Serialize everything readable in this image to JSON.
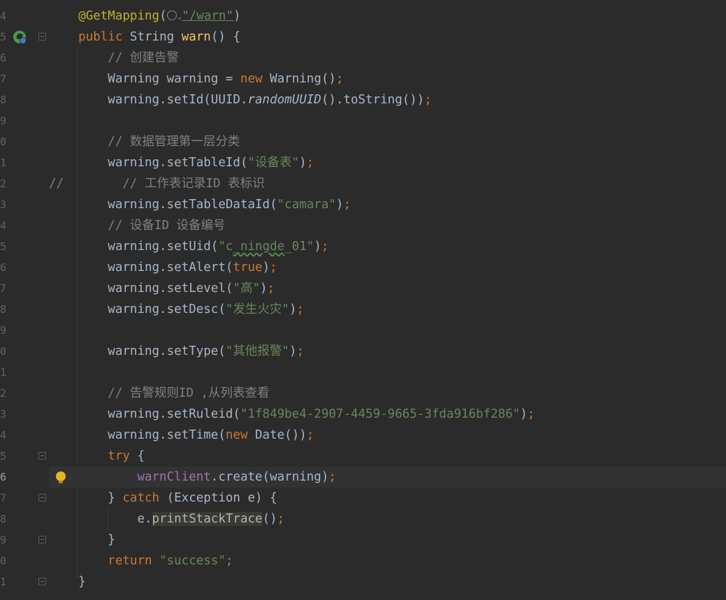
{
  "gutter": {
    "line_numbers": [
      "4",
      "5",
      "6",
      "7",
      "8",
      "9",
      "0",
      "1",
      "2",
      "3",
      "4",
      "5",
      "6",
      "7",
      "8",
      "9",
      "0",
      "1",
      "2",
      "3",
      "4",
      "5",
      "6",
      "7",
      "8",
      "9",
      "0",
      "1"
    ]
  },
  "code": {
    "l24_annotation": "@GetMapping",
    "l24_paren_open": "(",
    "l24_url": "\"/warn\"",
    "l24_paren_close": ")",
    "l25_public": "public",
    "l25_type": "String",
    "l25_method": "warn",
    "l25_rest": "() {",
    "l26_comment": "// 创建告警",
    "l27_type": "Warning warning = ",
    "l27_new": "new",
    "l27_call": " Warning()",
    "l27_semi": ";",
    "l28_a": "warning.setId(UUID.",
    "l28_it": "randomUUID",
    "l28_b": "().toString())",
    "l28_semi": ";",
    "l30_comment": "// 数据管理第一层分类",
    "l31_a": "warning.setTableId(",
    "l31_str": "\"设备表\"",
    "l31_b": ")",
    "l31_semi": ";",
    "l32_slashes": "//",
    "l32_comment": "// 工作表记录ID 表标识",
    "l33_a": "warning.setTableDataId(",
    "l33_str": "\"camara\"",
    "l33_b": ")",
    "l33_semi": ";",
    "l34_comment": "// 设备ID 设备编号",
    "l35_a": "warning.setUid(",
    "l35_q1": "\"c",
    "l35_typo": "_ningde",
    "l35_q2": "_01\"",
    "l35_b": ")",
    "l35_semi": ";",
    "l36_a": "warning.setAlert(",
    "l36_kw": "true",
    "l36_b": ")",
    "l36_semi": ";",
    "l37_a": "warning.setLevel(",
    "l37_str": "\"高\"",
    "l37_b": ")",
    "l37_semi": ";",
    "l38_a": "warning.setDesc(",
    "l38_str": "\"发生火灾\"",
    "l38_b": ")",
    "l38_semi": ";",
    "l40_a": "warning.setType(",
    "l40_str": "\"其他报警\"",
    "l40_b": ")",
    "l40_semi": ";",
    "l42_comment": "// 告警规则ID ,从列表查看",
    "l43_a": "warning.setRuleid(",
    "l43_str": "\"1f849be4-2907-4459-9665-3fda916bf286\"",
    "l43_b": ")",
    "l43_semi": ";",
    "l44_a": "warning.setTime(",
    "l44_new": "new",
    "l44_b": " Date())",
    "l44_semi": ";",
    "l45_try": "try",
    "l45_b": " {",
    "l46_field": "warnClient",
    "l46_b": ".create(warning)",
    "l46_semi": ";",
    "l47_a": "} ",
    "l47_catch": "catch",
    "l47_b": " (Exception e) {",
    "l48_a": "e.",
    "l48_call": "printStackTrace",
    "l48_b": "()",
    "l48_semi": ";",
    "l49_a": "}",
    "l50_return": "return",
    "l50_str": " \"success\"",
    "l50_semi": ";",
    "l51_a": "}"
  },
  "colors": {
    "background": "#2b2b2b",
    "keyword": "#cc7832",
    "string": "#6a8759",
    "comment": "#808080",
    "method_decl": "#ffc66d",
    "annotation": "#bbb529",
    "field": "#9876aa",
    "text": "#a9b7c6"
  },
  "icons": [
    "spring-bean-icon",
    "lightbulb-intention-icon",
    "globe-icon",
    "chevron-down-icon",
    "fold-marker-icon"
  ]
}
